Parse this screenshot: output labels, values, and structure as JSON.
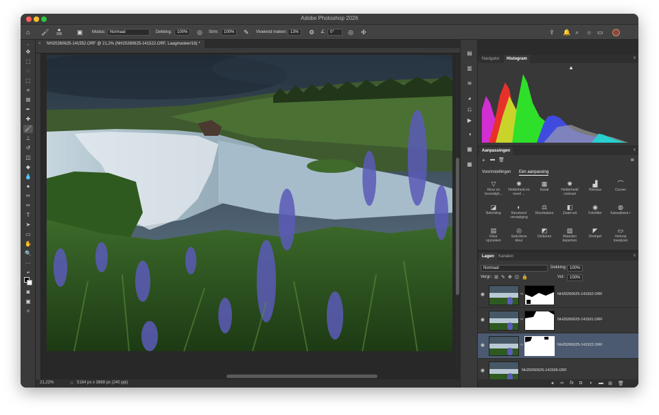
{
  "window": {
    "title": "Adobe Photoshop 2026",
    "colors": {
      "close": "#ff5f57",
      "minimize": "#febc2e",
      "zoom": "#28c840"
    }
  },
  "options_bar": {
    "brush_size": "200",
    "mode_label": "Modus:",
    "mode_value": "Normaal",
    "opacity_label": "Dekking:",
    "opacity_value": "100%",
    "flow_label": "Strm:",
    "flow_value": "100%",
    "smoothing_label": "Vloeiend maken:",
    "smoothing_value": "13%",
    "angle_value": "0°"
  },
  "document_tab": {
    "title": "NH20260625-141552.ORF @ 21,2% (NH20260625-141522.ORF, Laagmasker/16) *"
  },
  "status_bar": {
    "zoom": "21,22%",
    "doc_info": "5184 px x 3888 px (240 ppi)"
  },
  "navigator_panel": {
    "tabs": [
      "Navigator",
      "Histogram"
    ],
    "active_tab": "Histogram"
  },
  "adjustments_panel": {
    "title": "Aanpassingen",
    "subtabs": [
      "Voorinstellingen",
      "Eén aanpassing"
    ],
    "active_subtab": "Eén aanpassing",
    "items": [
      {
        "label": "Kleur en levendigh...",
        "icon": "triangle-icon"
      },
      {
        "label": "Helderheid en nevel ...",
        "icon": "sun-icon"
      },
      {
        "label": "Kanal",
        "icon": "grid-icon"
      },
      {
        "label": "Helderheid/ contrast",
        "icon": "sun-icon"
      },
      {
        "label": "Niveaus",
        "icon": "levels-icon"
      },
      {
        "label": "Curven",
        "icon": "curves-icon"
      },
      {
        "label": "Belichting",
        "icon": "exposure-icon"
      },
      {
        "label": "Kleurtoon/ verzadiging",
        "icon": "hue-icon"
      },
      {
        "label": "Kleurbalans",
        "icon": "balance-icon"
      },
      {
        "label": "Zwart-wit",
        "icon": "bw-icon"
      },
      {
        "label": "Fotofilter",
        "icon": "camera-icon"
      },
      {
        "label": "Kanaalmixe r",
        "icon": "mixer-icon"
      },
      {
        "label": "Kleur opzoeken",
        "icon": "lookup-icon"
      },
      {
        "label": "Selectieve kleur",
        "icon": "selective-icon"
      },
      {
        "label": "Omkeren",
        "icon": "invert-icon"
      },
      {
        "label": "Waarden beperken",
        "icon": "posterize-icon"
      },
      {
        "label": "Drempel",
        "icon": "threshold-icon"
      },
      {
        "label": "Verloop toewijzen",
        "icon": "gradient-icon"
      }
    ]
  },
  "layers_panel": {
    "tabs": [
      "Lagen",
      "Kanalen"
    ],
    "active_tab": "Lagen",
    "blend_mode": "Normaal",
    "opacity_label": "Dekking:",
    "opacity_value": "100%",
    "lock_label": "Vergr.:",
    "fill_label": "Vul:",
    "fill_value": "100%",
    "layers": [
      {
        "name": "NH20260625-141552.ORF",
        "has_mask": true,
        "selected": false
      },
      {
        "name": "NH20260625-141501.ORF",
        "has_mask": true,
        "selected": false
      },
      {
        "name": "NH20260625-141522.ORF",
        "has_mask": true,
        "selected": true
      },
      {
        "name": "NH20260625-141509.ORF",
        "has_mask": false,
        "selected": false
      }
    ]
  }
}
